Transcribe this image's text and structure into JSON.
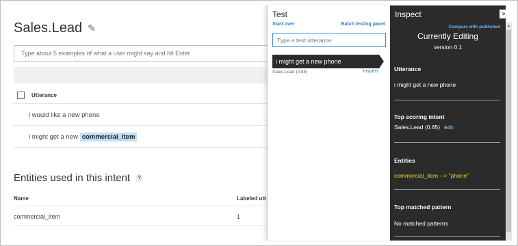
{
  "main": {
    "title": "Sales.Lead",
    "utterance_placeholder": "Type about 5 examples of what a user might say and hit Enter",
    "table_header": "Utterance",
    "utterances": [
      {
        "text": "i would like a new phone",
        "entity": ""
      },
      {
        "text": "i might get a new",
        "entity": "commercial_item"
      }
    ],
    "entities_title": "Entities used in this intent",
    "entities_help": "?",
    "entities_columns": [
      "Name",
      "Labeled utt"
    ],
    "entities_rows": [
      {
        "name": "commercial_item",
        "count": "1"
      }
    ]
  },
  "test": {
    "title": "Test",
    "start_over": "Start over",
    "batch": "Batch testing panel",
    "input_placeholder": "Type a test utterance",
    "bubble_text": "i might get a new phone",
    "result": "Sales.Lead (0.85)",
    "inspect_link": "Inspect"
  },
  "inspect": {
    "title": "Inspect",
    "close_icon": "chevron-right-icon",
    "compare_link": "Compare with published",
    "editing": "Currently Editing",
    "version": "version 0.1",
    "utterance_label": "Utterance",
    "utterance_value": "i might get a new phone",
    "intent_label": "Top scoring intent",
    "intent_value": "Sales.Lead (0.85)",
    "edit_link": "Edit",
    "entities_label": "Entities",
    "entities_value": "commercial_item --> \"phone\"",
    "pattern_label": "Top matched pattern",
    "pattern_value": "No matched patterns"
  },
  "colors": {
    "accent": "#2f78c4",
    "inspect_bg": "#2b2b2b",
    "entity_highlight": "#bde0f5",
    "entity_yellow": "#f0d020"
  }
}
